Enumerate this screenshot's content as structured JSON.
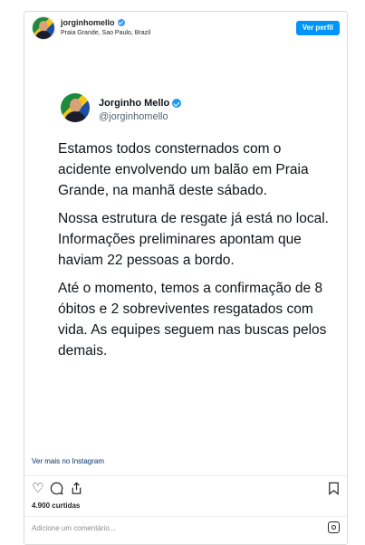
{
  "header": {
    "username": "jorginhomello",
    "location": "Praia Grande, Sao Paulo, Brazil",
    "profile_button": "Ver perfil"
  },
  "tweet": {
    "name": "Jorginho Mello",
    "handle": "@jorginhomello",
    "paragraphs": [
      "Estamos todos consternados com o acidente envolvendo um balão em Praia Grande, na manhã deste sábado.",
      "Nossa estrutura de resgate já está no local. Informações preliminares apontam que haviam 22 pessoas a bordo.",
      "Até o momento, temos a confirmação de 8 óbitos e 2 sobreviventes resgatados com vida. As equipes seguem nas buscas pelos demais."
    ]
  },
  "footer": {
    "more_link": "Ver mais no Instagram",
    "likes": "4.900 curtidas",
    "comment_placeholder": "Adicione um comentário..."
  },
  "icons": {
    "like": "heart-icon",
    "comment": "comment-icon",
    "share": "share-icon",
    "save": "bookmark-icon",
    "brand": "instagram-icon"
  },
  "colors": {
    "button": "#0095f6",
    "verified": "#1d9bf0",
    "link": "#00376b"
  }
}
